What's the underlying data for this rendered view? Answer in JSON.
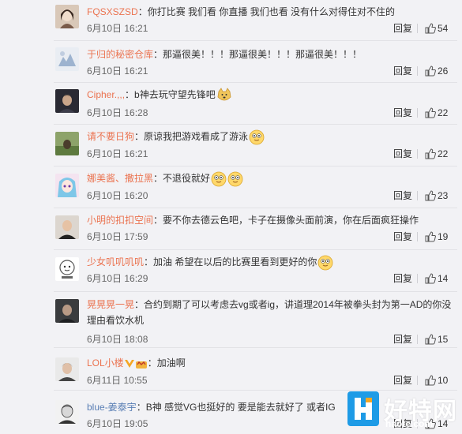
{
  "comments": [
    {
      "user": "FQSXSZSD",
      "text": "你打比赛 我们看 你直播 我们也看 没有什么对得住对不住的",
      "date": "6月10日 16:21",
      "reply": "回复",
      "likes": "54"
    },
    {
      "user": "于归的秘密仓库",
      "text": "那逼很美！！！那逼很美！！！那逼很美！！！",
      "date": "6月10日 16:21",
      "reply": "回复",
      "likes": "26"
    },
    {
      "user": "Cipher.,,,",
      "text": "b神去玩守望先锋吧",
      "date": "6月10日 16:28",
      "reply": "回复",
      "likes": "22"
    },
    {
      "user": "请不要日狗",
      "text": "原谅我把游戏看成了游泳",
      "date": "6月10日 16:21",
      "reply": "回复",
      "likes": "22"
    },
    {
      "user": "娜美酱、撒拉黑",
      "text": "不退役就好",
      "date": "6月10日 16:20",
      "reply": "回复",
      "likes": "23"
    },
    {
      "user": "小明的扣扣空间",
      "text": "要不你去德云色吧，卡子在摄像头面前演，你在后面疯狂操作",
      "date": "6月10日 17:59",
      "reply": "回复",
      "likes": "19"
    },
    {
      "user": "少女叽叽叽叽",
      "text": "加油 希望在以后的比赛里看到更好的你",
      "date": "6月10日 16:29",
      "reply": "回复",
      "likes": "14"
    },
    {
      "user": "晃晃晃一晃",
      "text": "合约到期了可以考虑去vg或者ig，讲道理2014年被拳头封为第一AD的你没理由看饮水机",
      "date": "6月10日 18:08",
      "reply": "回复",
      "likes": "15"
    },
    {
      "user": "LOL小楼",
      "text": "加油啊",
      "date": "6月11日 10:55",
      "reply": "回复",
      "likes": "10"
    },
    {
      "user": "blue-姜泰宇",
      "text": "B神 感觉VG也挺好的 要是能去就好了 或者IG",
      "date": "6月10日 19:05",
      "reply": "回复",
      "likes": "14"
    }
  ],
  "watermark": {
    "brand": "好特网",
    "url": "haote.com"
  },
  "colors": {
    "username": "#eb7350",
    "background": "#f2f2f5",
    "watermark_blue": "#1e9be6"
  }
}
